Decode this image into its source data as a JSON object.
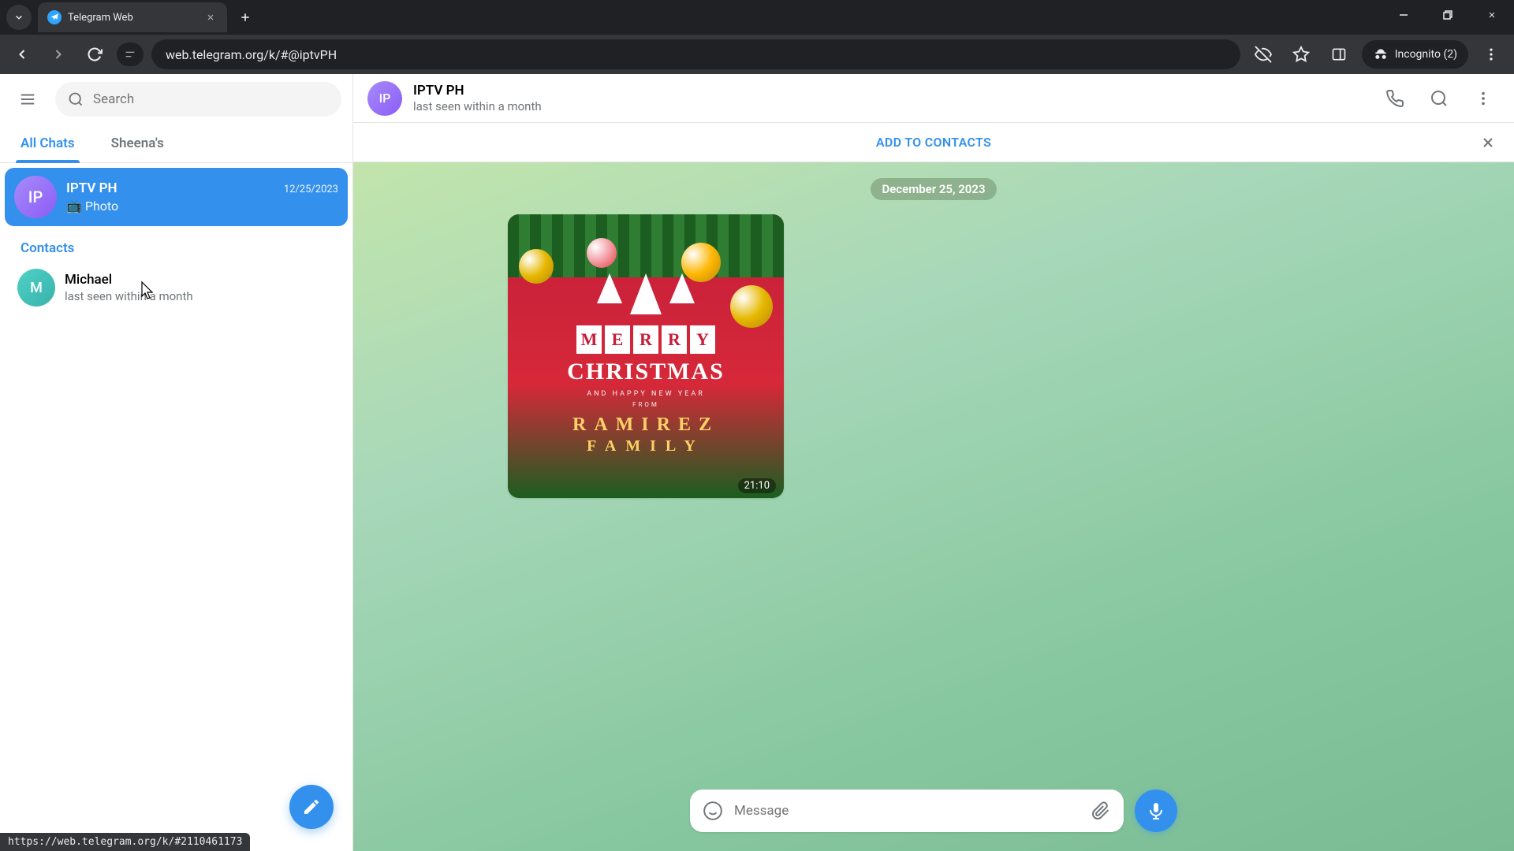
{
  "browser": {
    "tab_title": "Telegram Web",
    "url": "web.telegram.org/k/#@iptvPH",
    "incognito_label": "Incognito (2)",
    "status_link": "https://web.telegram.org/k/#2110461173"
  },
  "sidebar": {
    "search_placeholder": "Search",
    "tabs": [
      {
        "label": "All Chats",
        "active": true
      },
      {
        "label": "Sheena's",
        "active": false
      }
    ],
    "chats": [
      {
        "initials": "IP",
        "name": "IPTV PH",
        "date": "12/25/2023",
        "preview_icon": "📺",
        "preview_text": "Photo",
        "selected": true
      }
    ],
    "contacts_label": "Contacts",
    "contacts": [
      {
        "initials": "M",
        "name": "Michael",
        "status": "last seen within a month"
      }
    ]
  },
  "chat": {
    "header": {
      "initials": "IP",
      "name": "IPTV PH",
      "status": "last seen within a month"
    },
    "add_contacts": "ADD TO CONTACTS",
    "date_label": "December 25, 2023",
    "photo_message": {
      "merry": [
        "M",
        "E",
        "R",
        "R",
        "Y"
      ],
      "christmas": "CHRISTMAS",
      "sub1": "AND HAPPY NEW YEAR",
      "sub2": "FROM",
      "family1": "RAMIREZ",
      "family2": "FAMILY",
      "time": "21:10"
    },
    "composer_placeholder": "Message"
  }
}
